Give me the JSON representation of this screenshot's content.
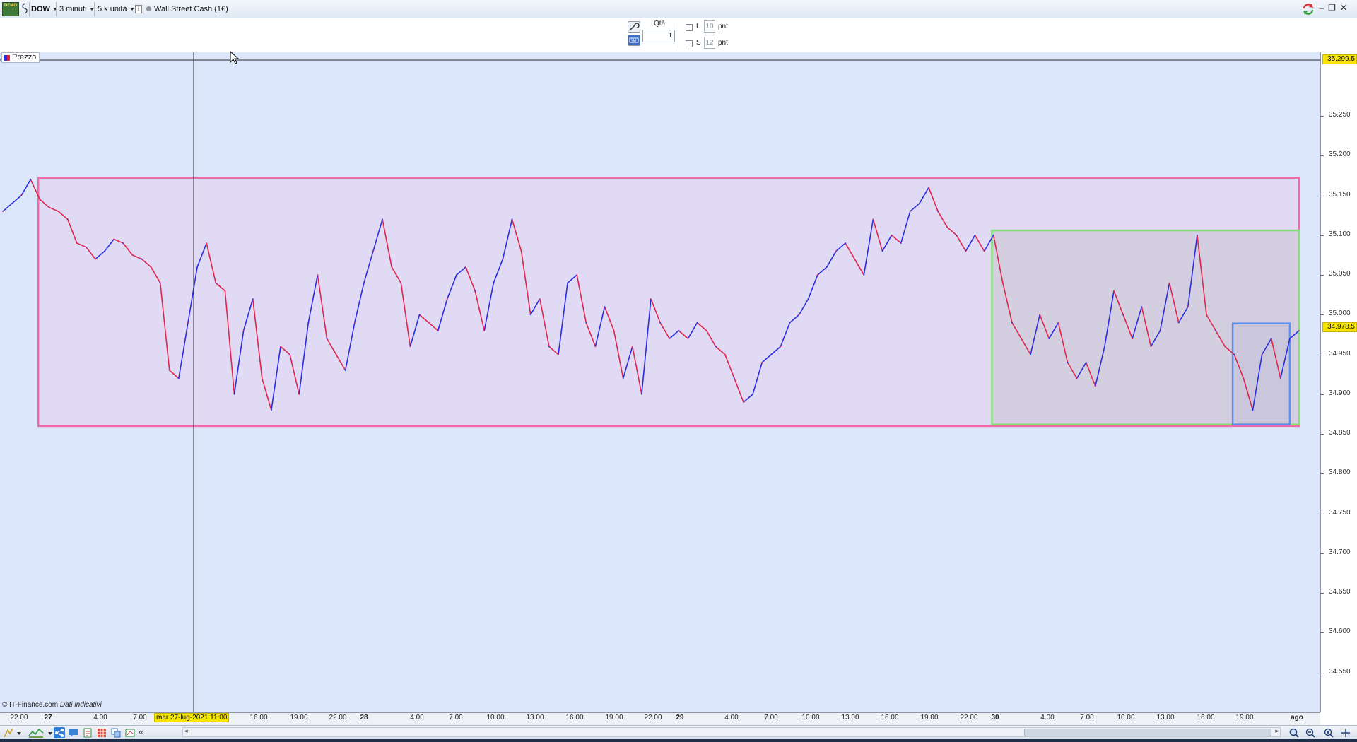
{
  "toolbar": {
    "logo_text": "DEMO",
    "symbol": "DOW",
    "timeframe": "3 minuti",
    "units": "5 k unità",
    "info_icon": "i",
    "instrument": "Wall Street Cash (1€)"
  },
  "order_panel": {
    "qty_label": "Qtà",
    "qty_value": "1",
    "long_label": "L",
    "long_points": "10",
    "short_label": "S",
    "short_points": "12",
    "points_unit": "pnt"
  },
  "chart": {
    "series_label": "Prezzo",
    "copyright": "© IT-Finance.com",
    "disclaimer": "Dati indicativi",
    "cursor_date": "mar 27-lug-2021 11:00",
    "cursor_price": "35.299,5",
    "last_price": "34.978,5",
    "colors": {
      "background": "#dde7fb",
      "up": "#2a2ee0",
      "down": "#e0244c",
      "box_pink": "#f06aa8",
      "box_green": "#86e07a",
      "box_blue": "#5a8ef0"
    }
  },
  "chart_data": {
    "type": "line",
    "title": "",
    "ylim": [
      34500,
      35330
    ],
    "y_ticks": [
      "35.250",
      "35.200",
      "35.150",
      "35.100",
      "35.050",
      "35.000",
      "34.950",
      "34.900",
      "34.850",
      "34.800",
      "34.750",
      "34.700",
      "34.650",
      "34.600",
      "34.550"
    ],
    "x_ticks": [
      {
        "label": "22.00",
        "day": false
      },
      {
        "label": "27",
        "day": true
      },
      {
        "label": "4.00",
        "day": false
      },
      {
        "label": "7.00",
        "day": false
      },
      {
        "label": "16.00",
        "day": false
      },
      {
        "label": "19.00",
        "day": false
      },
      {
        "label": "22.00",
        "day": false
      },
      {
        "label": "28",
        "day": true
      },
      {
        "label": "4.00",
        "day": false
      },
      {
        "label": "7.00",
        "day": false
      },
      {
        "label": "10.00",
        "day": false
      },
      {
        "label": "13.00",
        "day": false
      },
      {
        "label": "16.00",
        "day": false
      },
      {
        "label": "19.00",
        "day": false
      },
      {
        "label": "22.00",
        "day": false
      },
      {
        "label": "29",
        "day": true
      },
      {
        "label": "4.00",
        "day": false
      },
      {
        "label": "7.00",
        "day": false
      },
      {
        "label": "10.00",
        "day": false
      },
      {
        "label": "13.00",
        "day": false
      },
      {
        "label": "16.00",
        "day": false
      },
      {
        "label": "19.00",
        "day": false
      },
      {
        "label": "22.00",
        "day": false
      },
      {
        "label": "30",
        "day": true
      },
      {
        "label": "4.00",
        "day": false
      },
      {
        "label": "7.00",
        "day": false
      },
      {
        "label": "10.00",
        "day": false
      },
      {
        "label": "13.00",
        "day": false
      },
      {
        "label": "16.00",
        "day": false
      },
      {
        "label": "19.00",
        "day": false
      },
      {
        "label": "ago",
        "day": true
      }
    ],
    "series": [
      {
        "values": [
          35130,
          35140,
          35150,
          35170,
          35145,
          35135,
          35130,
          35120,
          35090,
          35085,
          35070,
          35080,
          35095,
          35090,
          35075,
          35070,
          35060,
          35040,
          34930,
          34920,
          34990,
          35060,
          35090,
          35040,
          35030,
          34900,
          34980,
          35020,
          34920,
          34880,
          34960,
          34950,
          34900,
          34990,
          35050,
          34970,
          34950,
          34930,
          34990,
          35040,
          35080,
          35120,
          35060,
          35040,
          34960,
          35000,
          34990,
          34980,
          35020,
          35050,
          35060,
          35030,
          34980,
          35040,
          35070,
          35120,
          35080,
          35000,
          35020,
          34960,
          34950,
          35040,
          35050,
          34990,
          34960,
          35010,
          34980,
          34920,
          34960,
          34900,
          35020,
          34990,
          34970,
          34980,
          34970,
          34990,
          34980,
          34960,
          34950,
          34920,
          34890,
          34900,
          34940,
          34950,
          34960,
          34990,
          35000,
          35020,
          35050,
          35060,
          35080,
          35090,
          35070,
          35050,
          35120,
          35080,
          35100,
          35090,
          35130,
          35140,
          35160,
          35130,
          35110,
          35100,
          35080,
          35100,
          35080,
          35100,
          35040,
          34990,
          34970,
          34950,
          35000,
          34970,
          34990,
          34940,
          34920,
          34940,
          34910,
          34960,
          35030,
          35000,
          34970,
          35010,
          34960,
          34980,
          35040,
          34990,
          35010,
          35100,
          35000,
          34980,
          34960,
          34950,
          34920,
          34880,
          34950,
          34970,
          34920,
          34970,
          34980
        ]
      }
    ],
    "annotations": [
      {
        "type": "rectangle",
        "color": "pink",
        "from_index": 2,
        "to_index": 140,
        "y_top": 35172,
        "y_bottom": 34860
      },
      {
        "type": "rectangle",
        "color": "green",
        "from_index": 105,
        "to_index": 140,
        "y_top": 35106,
        "y_bottom": 34862
      },
      {
        "type": "rectangle",
        "color": "blue",
        "from_index": 131,
        "to_index": 139,
        "y_top": 34989,
        "y_bottom": 34862
      }
    ]
  }
}
